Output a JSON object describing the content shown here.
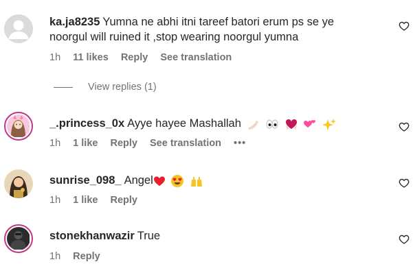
{
  "comments": [
    {
      "username": "ka.ja8235",
      "text_line1": "Yumna ne abhi itni tareef batori erum ps se ye",
      "text_line2": "noorgul will ruined it ,stop wearing noorgul yumna",
      "time": "1h",
      "likes": "11 likes",
      "reply": "Reply",
      "translate": "See translation",
      "view_replies": "View replies (1)"
    },
    {
      "username": "_.princess_0x",
      "text": "Ayye hayee Mashallah",
      "time": "1h",
      "likes": "1 like",
      "reply": "Reply",
      "translate": "See translation",
      "more": "•••"
    },
    {
      "username": "sunrise_098_",
      "text": "Angel",
      "time": "1h",
      "likes": "1 like",
      "reply": "Reply"
    },
    {
      "username": "stonekhanwazir",
      "text": "True",
      "time": "1h",
      "reply": "Reply"
    }
  ],
  "icons": {
    "like": "heart-outline-icon",
    "default_avatar": "default-profile-icon"
  },
  "colors": {
    "text": "#262626",
    "secondary": "#737373",
    "story_ring": "#c13584"
  }
}
